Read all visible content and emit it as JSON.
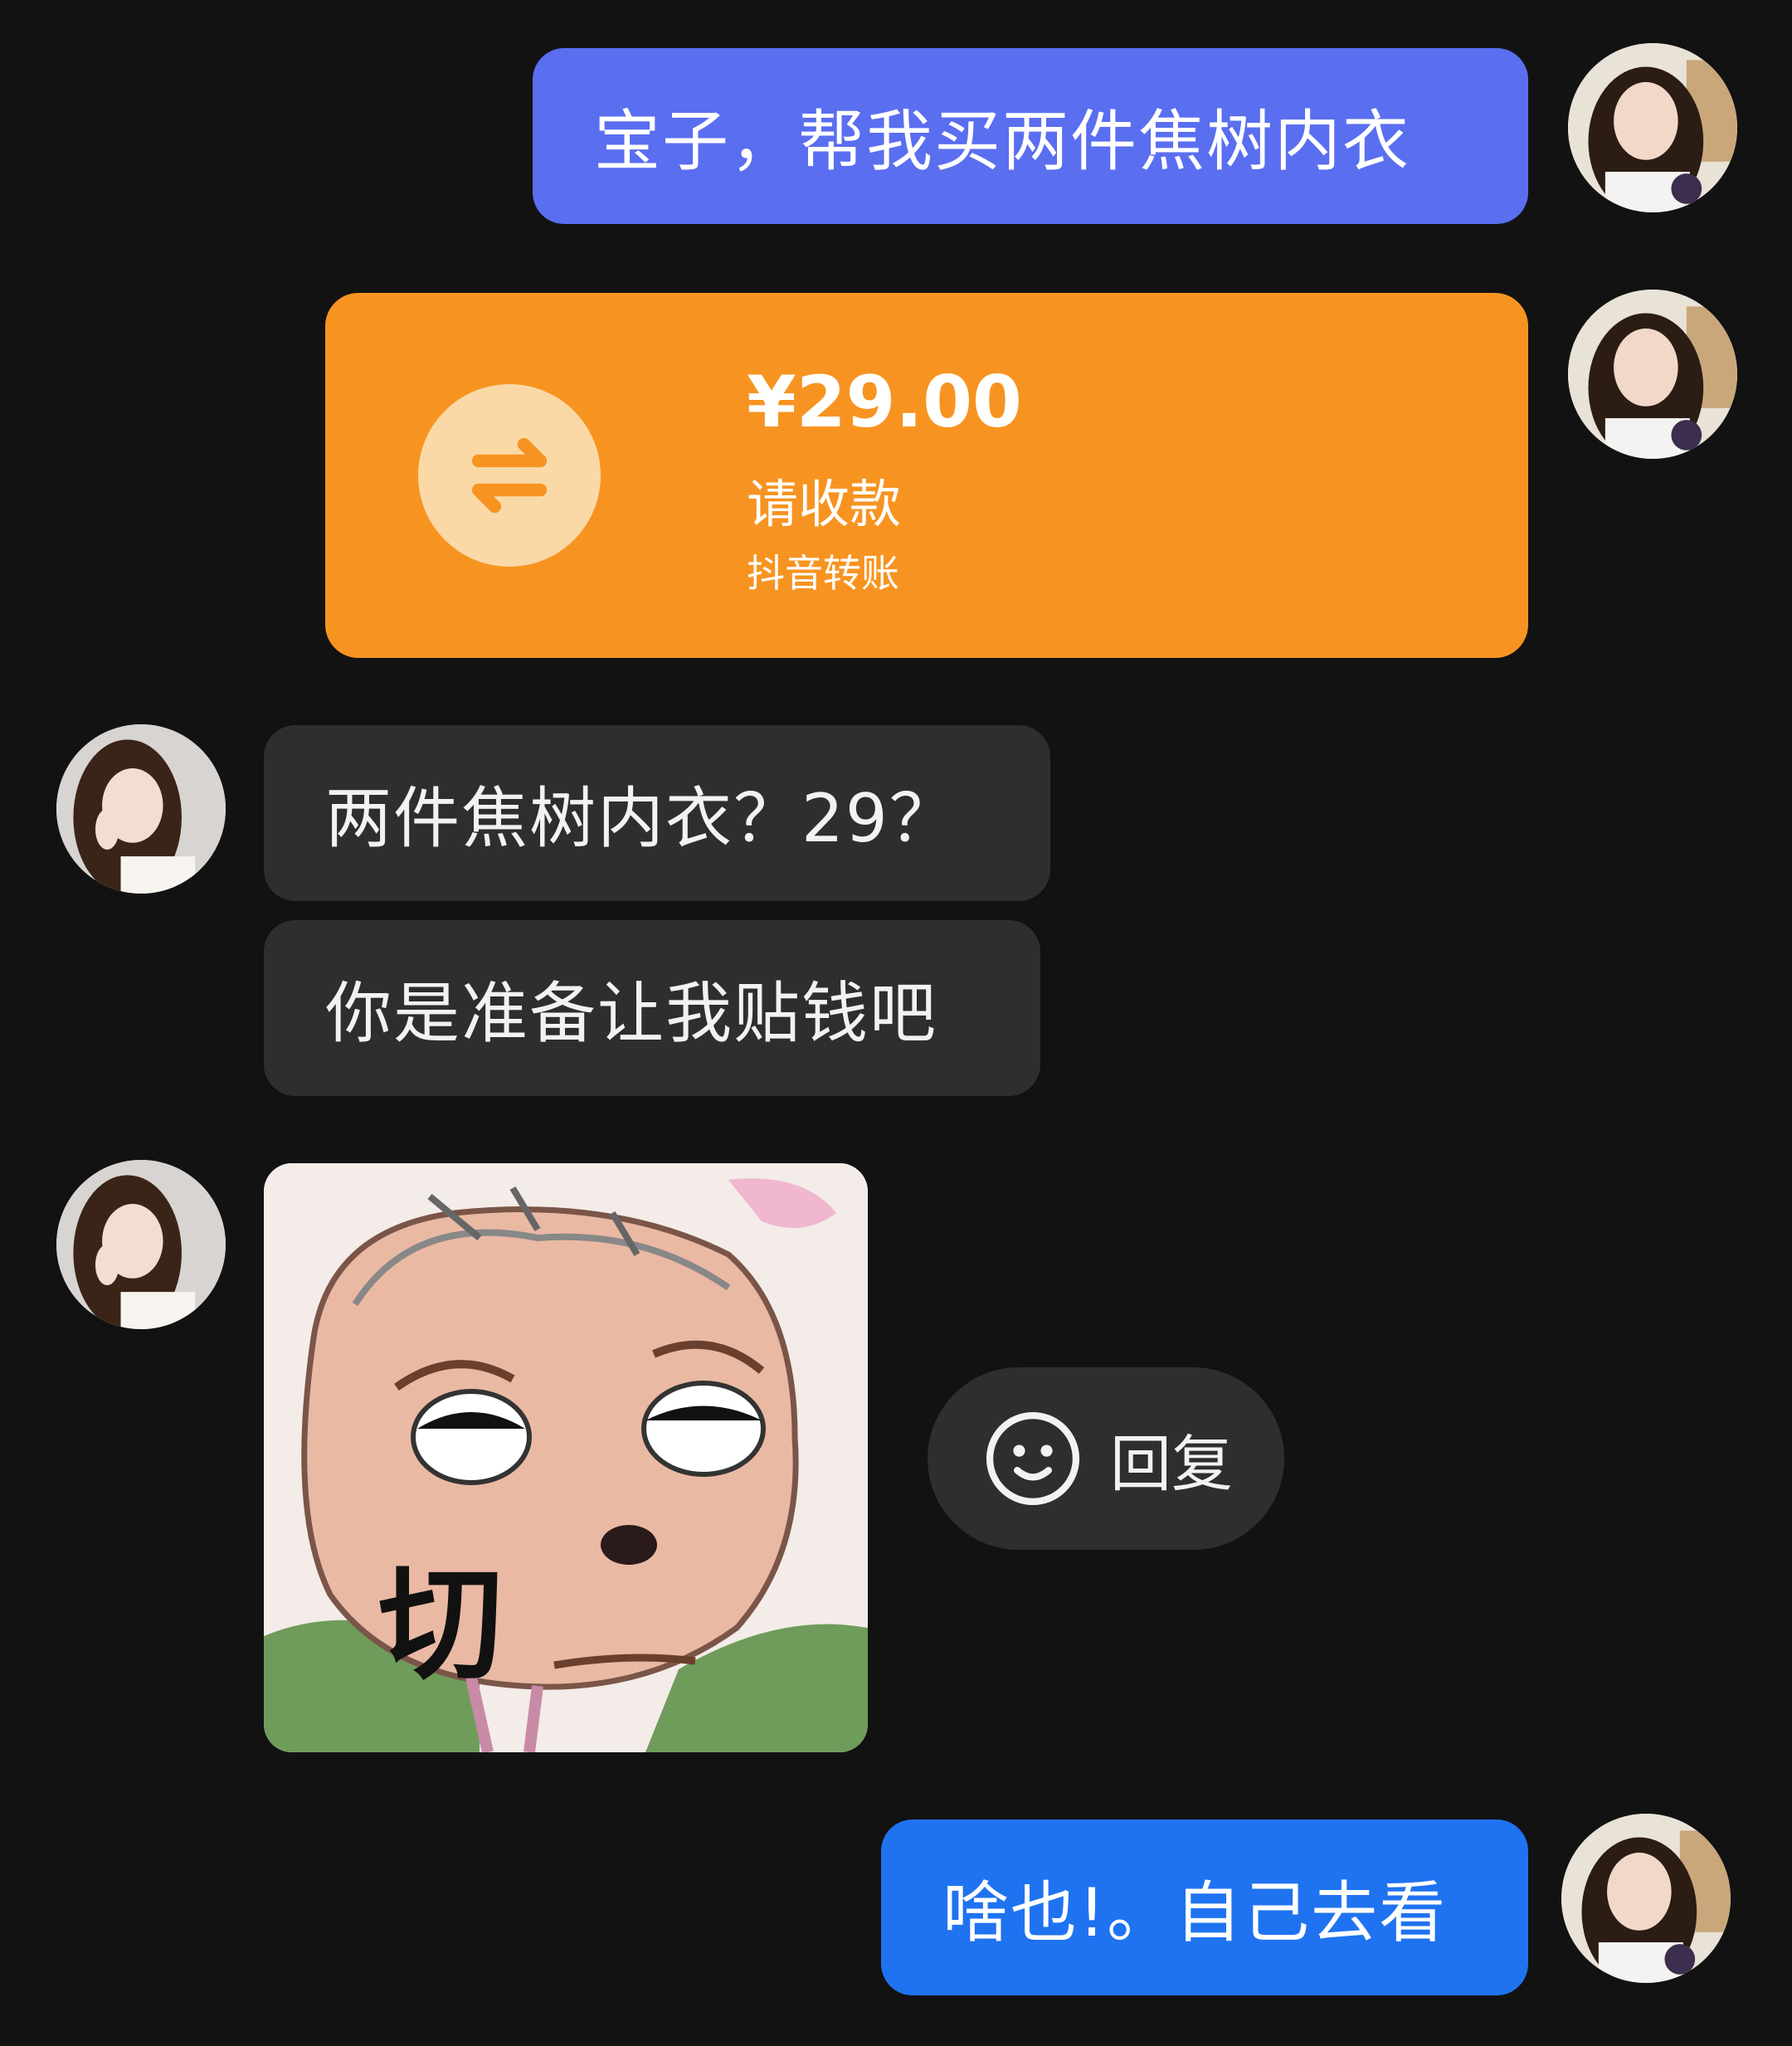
{
  "messages": {
    "m1": {
      "text": "宝子，帮我买两件焦树内衣"
    },
    "transfer": {
      "amount": "¥29.00",
      "status": "请收款",
      "label": "抖音转账",
      "icon": "swap-arrows-icon"
    },
    "m2": {
      "text": "两件焦树内衣？29？"
    },
    "m3": {
      "text": "你是准备让我贴钱吧"
    },
    "sticker": {
      "caption": "切"
    },
    "m4": {
      "text": "啥也!。自己去看"
    }
  },
  "reply": {
    "label": "回复",
    "icon": "smiley-icon"
  },
  "colors": {
    "background": "#121212",
    "sent_purple": "#5a6ef0",
    "sent_blue": "#1f73f0",
    "received_gray": "#2e2e2e",
    "transfer_orange": "#f79421"
  }
}
